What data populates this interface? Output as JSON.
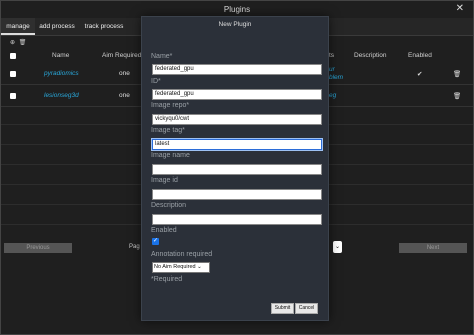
{
  "window": {
    "title": "Plugins",
    "close_label": "✕"
  },
  "tabs": [
    {
      "label": "manage"
    },
    {
      "label": "add process"
    },
    {
      "label": "track process"
    }
  ],
  "table": {
    "headers": {
      "name": "Name",
      "aim_required": "Aim Required",
      "projects": "ts",
      "description": "Description",
      "enabled": "Enabled"
    },
    "rows": [
      {
        "name": "pyradiomics",
        "aim": "one",
        "project": "ur",
        "project2": "blem",
        "enabled": "✔"
      },
      {
        "name": "lesionseg3d",
        "aim": "one",
        "project": "eg",
        "enabled": ""
      }
    ]
  },
  "pager": {
    "previous": "Previous",
    "page_prefix": "Pag",
    "next": "Next"
  },
  "modal": {
    "title": "New Plugin",
    "name_label": "Name*",
    "name_value": "federated_gpu",
    "id_label": "ID*",
    "id_value": "federated_gpu",
    "repo_label": "Image repo*",
    "repo_value": "vickyqu0/cwt",
    "tag_label": "Image tag*",
    "tag_value": "latest",
    "image_name_label": "Image name",
    "image_id_label": "Image id",
    "description_label": "Description",
    "enabled_label": "Enabled",
    "annotation_label": "Annotation required",
    "annotation_value": "No Aim Required",
    "required_note": "*Required",
    "submit": "Submit",
    "cancel": "Cancel"
  },
  "icons": {
    "add": "plus-circle-icon",
    "delete": "trash-icon",
    "check": "checkmark-icon"
  }
}
